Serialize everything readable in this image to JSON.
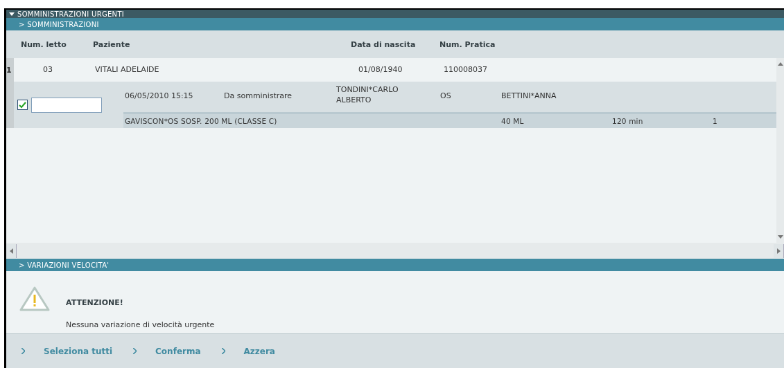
{
  "panel": {
    "title": "SOMMINISTRAZIONI URGENTI",
    "expanded": true
  },
  "section_1": {
    "title": "> SOMMINISTRAZIONI"
  },
  "columns": [
    "Num. letto",
    "Paziente",
    "Data di nascita",
    "Num. Pratica"
  ],
  "patients": [
    {
      "index": "1",
      "bed": "03",
      "name": "VITALI  ADELAIDE",
      "birth_date": "01/08/1940",
      "case_number": "110008037",
      "administrations": [
        {
          "checked": true,
          "datetime": "06/05/2010 15:15",
          "status": "Da somministrare",
          "prescriber": "TONDINI*CARLO ALBERTO",
          "route": "OS",
          "nurse": "BETTINI*ANNA",
          "drug": "GAVISCON*OS SOSP. 200 ML (CLASSE C)",
          "dose": "40 ML",
          "duration": "120 min",
          "quantity": "1"
        }
      ]
    }
  ],
  "section_2": {
    "title": "> VARIAZIONI VELOCITA'"
  },
  "warning": {
    "title": "ATTENZIONE!",
    "message": "Nessuna variazione di velocità urgente"
  },
  "actions": [
    "Seleziona tutti",
    "Conferma",
    "Azzera"
  ]
}
